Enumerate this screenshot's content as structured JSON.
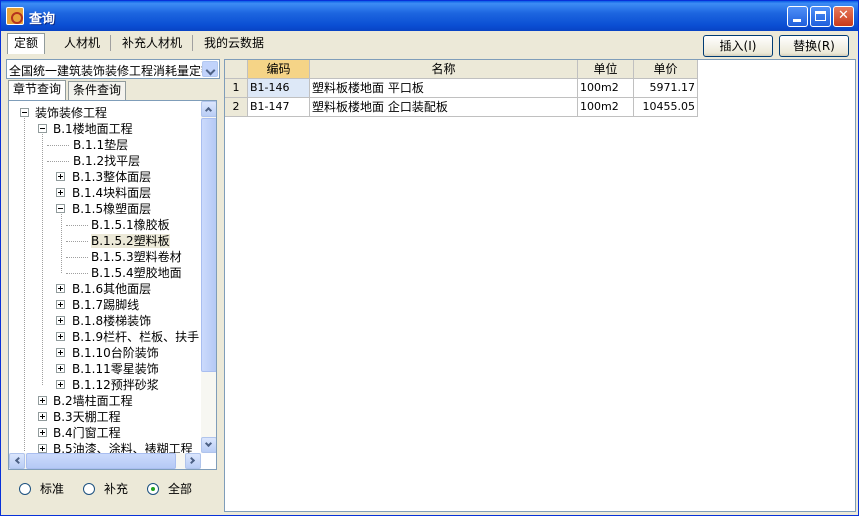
{
  "window": {
    "title": "查询"
  },
  "top_tabs": [
    "定额",
    "人材机",
    "补充人材机",
    "我的云数据"
  ],
  "buttons": {
    "insert": "插入(I)",
    "replace": "替换(R)"
  },
  "left": {
    "library": "全国统一建筑装饰装修工程消耗量定额",
    "sub_tabs": [
      "章节查询",
      "条件查询"
    ],
    "tree": [
      "装饰装修工程",
      "B.1楼地面工程",
      "B.1.1垫层",
      "B.1.2找平层",
      "B.1.3整体面层",
      "B.1.4块料面层",
      "B.1.5橡塑面层",
      "B.1.5.1橡胶板",
      "B.1.5.2塑料板",
      "B.1.5.3塑料卷材",
      "B.1.5.4塑胶地面",
      "B.1.6其他面层",
      "B.1.7踢脚线",
      "B.1.8楼梯装饰",
      "B.1.9栏杆、栏板、扶手",
      "B.1.10台阶装饰",
      "B.1.11零星装饰",
      "B.1.12预拌砂浆",
      "B.2墙柱面工程",
      "B.3天棚工程",
      "B.4门窗工程",
      "B.5油漆、涂料、裱糊工程"
    ],
    "filters": [
      "标准",
      "补充",
      "全部"
    ]
  },
  "table": {
    "columns": [
      "编码",
      "名称",
      "单位",
      "单价"
    ],
    "rows": [
      {
        "no": "1",
        "code": "B1-146",
        "name": "塑料板楼地面 平口板",
        "unit": "100m2",
        "price": "5971.17"
      },
      {
        "no": "2",
        "code": "B1-147",
        "name": "塑料板楼地面 企口装配板",
        "unit": "100m2",
        "price": "10455.05"
      }
    ]
  }
}
